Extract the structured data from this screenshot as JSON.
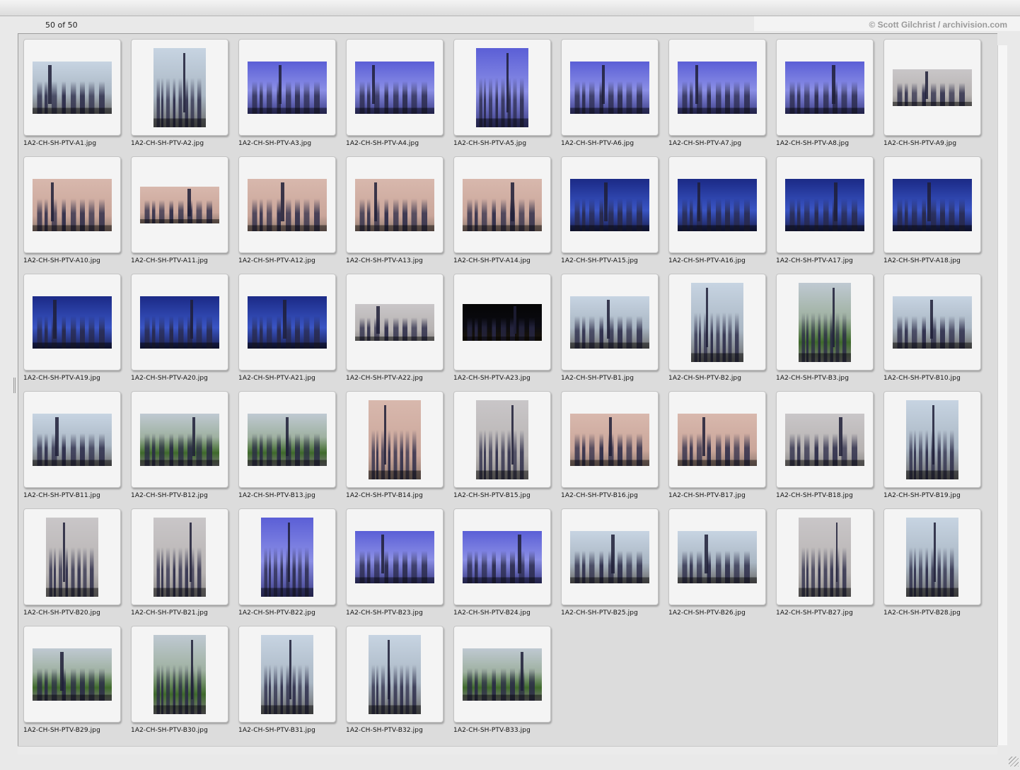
{
  "browser": {
    "counter": "50 of 50",
    "credit": "© Scott Gilchrist / archivision.com"
  },
  "thumbnails": [
    {
      "filename": "1A2-CH-SH-PTV-A1.jpg",
      "orientation": "landscape",
      "tone": "day"
    },
    {
      "filename": "1A2-CH-SH-PTV-A2.jpg",
      "orientation": "portrait",
      "tone": "day"
    },
    {
      "filename": "1A2-CH-SH-PTV-A3.jpg",
      "orientation": "landscape",
      "tone": "blue"
    },
    {
      "filename": "1A2-CH-SH-PTV-A4.jpg",
      "orientation": "landscape",
      "tone": "blue"
    },
    {
      "filename": "1A2-CH-SH-PTV-A5.jpg",
      "orientation": "portrait",
      "tone": "blue"
    },
    {
      "filename": "1A2-CH-SH-PTV-A6.jpg",
      "orientation": "landscape",
      "tone": "blue"
    },
    {
      "filename": "1A2-CH-SH-PTV-A7.jpg",
      "orientation": "landscape",
      "tone": "blue"
    },
    {
      "filename": "1A2-CH-SH-PTV-A8.jpg",
      "orientation": "landscape",
      "tone": "blue"
    },
    {
      "filename": "1A2-CH-SH-PTV-A9.jpg",
      "orientation": "wide",
      "tone": "haze"
    },
    {
      "filename": "1A2-CH-SH-PTV-A10.jpg",
      "orientation": "landscape",
      "tone": "pink"
    },
    {
      "filename": "1A2-CH-SH-PTV-A11.jpg",
      "orientation": "wide",
      "tone": "pink"
    },
    {
      "filename": "1A2-CH-SH-PTV-A12.jpg",
      "orientation": "landscape",
      "tone": "pink"
    },
    {
      "filename": "1A2-CH-SH-PTV-A13.jpg",
      "orientation": "landscape",
      "tone": "pink"
    },
    {
      "filename": "1A2-CH-SH-PTV-A14.jpg",
      "orientation": "landscape",
      "tone": "pink"
    },
    {
      "filename": "1A2-CH-SH-PTV-A15.jpg",
      "orientation": "landscape",
      "tone": "dusk"
    },
    {
      "filename": "1A2-CH-SH-PTV-A16.jpg",
      "orientation": "landscape",
      "tone": "dusk"
    },
    {
      "filename": "1A2-CH-SH-PTV-A17.jpg",
      "orientation": "landscape",
      "tone": "dusk"
    },
    {
      "filename": "1A2-CH-SH-PTV-A18.jpg",
      "orientation": "landscape",
      "tone": "dusk"
    },
    {
      "filename": "1A2-CH-SH-PTV-A19.jpg",
      "orientation": "landscape",
      "tone": "dusk"
    },
    {
      "filename": "1A2-CH-SH-PTV-A20.jpg",
      "orientation": "landscape",
      "tone": "dusk"
    },
    {
      "filename": "1A2-CH-SH-PTV-A21.jpg",
      "orientation": "landscape",
      "tone": "dusk"
    },
    {
      "filename": "1A2-CH-SH-PTV-A22.jpg",
      "orientation": "wide",
      "tone": "haze"
    },
    {
      "filename": "1A2-CH-SH-PTV-A23.jpg",
      "orientation": "wide",
      "tone": "night"
    },
    {
      "filename": "1A2-CH-SH-PTV-B1.jpg",
      "orientation": "landscape",
      "tone": "day"
    },
    {
      "filename": "1A2-CH-SH-PTV-B2.jpg",
      "orientation": "portrait",
      "tone": "day"
    },
    {
      "filename": "1A2-CH-SH-PTV-B3.jpg",
      "orientation": "portrait",
      "tone": "green"
    },
    {
      "filename": "1A2-CH-SH-PTV-B10.jpg",
      "orientation": "landscape",
      "tone": "day"
    },
    {
      "filename": "1A2-CH-SH-PTV-B11.jpg",
      "orientation": "landscape",
      "tone": "day"
    },
    {
      "filename": "1A2-CH-SH-PTV-B12.jpg",
      "orientation": "landscape",
      "tone": "green"
    },
    {
      "filename": "1A2-CH-SH-PTV-B13.jpg",
      "orientation": "landscape",
      "tone": "green"
    },
    {
      "filename": "1A2-CH-SH-PTV-B14.jpg",
      "orientation": "portrait",
      "tone": "pink"
    },
    {
      "filename": "1A2-CH-SH-PTV-B15.jpg",
      "orientation": "portrait",
      "tone": "haze"
    },
    {
      "filename": "1A2-CH-SH-PTV-B16.jpg",
      "orientation": "landscape",
      "tone": "pink"
    },
    {
      "filename": "1A2-CH-SH-PTV-B17.jpg",
      "orientation": "landscape",
      "tone": "pink"
    },
    {
      "filename": "1A2-CH-SH-PTV-B18.jpg",
      "orientation": "landscape",
      "tone": "haze"
    },
    {
      "filename": "1A2-CH-SH-PTV-B19.jpg",
      "orientation": "portrait",
      "tone": "day"
    },
    {
      "filename": "1A2-CH-SH-PTV-B20.jpg",
      "orientation": "portrait",
      "tone": "haze"
    },
    {
      "filename": "1A2-CH-SH-PTV-B21.jpg",
      "orientation": "portrait",
      "tone": "haze"
    },
    {
      "filename": "1A2-CH-SH-PTV-B22.jpg",
      "orientation": "portrait",
      "tone": "blue"
    },
    {
      "filename": "1A2-CH-SH-PTV-B23.jpg",
      "orientation": "landscape",
      "tone": "blue"
    },
    {
      "filename": "1A2-CH-SH-PTV-B24.jpg",
      "orientation": "landscape",
      "tone": "blue"
    },
    {
      "filename": "1A2-CH-SH-PTV-B25.jpg",
      "orientation": "landscape",
      "tone": "day"
    },
    {
      "filename": "1A2-CH-SH-PTV-B26.jpg",
      "orientation": "landscape",
      "tone": "day"
    },
    {
      "filename": "1A2-CH-SH-PTV-B27.jpg",
      "orientation": "portrait",
      "tone": "haze"
    },
    {
      "filename": "1A2-CH-SH-PTV-B28.jpg",
      "orientation": "portrait",
      "tone": "day"
    },
    {
      "filename": "1A2-CH-SH-PTV-B29.jpg",
      "orientation": "landscape",
      "tone": "green"
    },
    {
      "filename": "1A2-CH-SH-PTV-B30.jpg",
      "orientation": "portrait",
      "tone": "green"
    },
    {
      "filename": "1A2-CH-SH-PTV-B31.jpg",
      "orientation": "portrait",
      "tone": "day"
    },
    {
      "filename": "1A2-CH-SH-PTV-B32.jpg",
      "orientation": "portrait",
      "tone": "day"
    },
    {
      "filename": "1A2-CH-SH-PTV-B33.jpg",
      "orientation": "landscape",
      "tone": "green"
    }
  ]
}
